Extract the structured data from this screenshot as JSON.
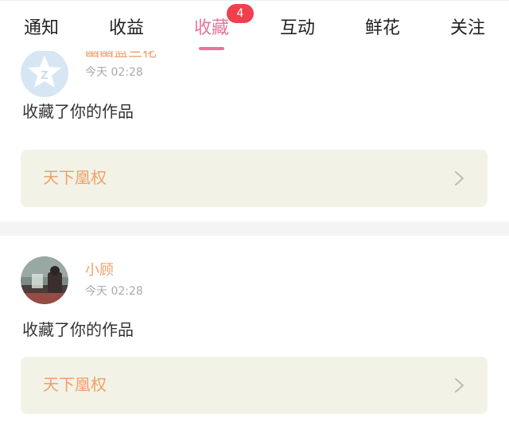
{
  "tabs": [
    {
      "label": "通知"
    },
    {
      "label": "收益"
    },
    {
      "label": "收藏",
      "badge": "4"
    },
    {
      "label": "互动"
    },
    {
      "label": "鲜花"
    },
    {
      "label": "关注"
    }
  ],
  "active_tab": "收藏",
  "colors": {
    "accent": "#e8739c",
    "badge": "#f0404f",
    "username": "#f0a06a",
    "work_box": "#f2f3e6",
    "divider": "#f4f4f4"
  },
  "notifications": [
    {
      "username": "幽幽蓝兰花",
      "time": "今天 02:28",
      "action": "收藏了你的作品",
      "work_title": "天下凰权",
      "avatar_icon": "qq-default-avatar-icon"
    },
    {
      "username": "小顾",
      "time": "今天 02:28",
      "action": "收藏了你的作品",
      "work_title": "天下凰权",
      "avatar_icon": "photo-avatar-icon"
    }
  ]
}
